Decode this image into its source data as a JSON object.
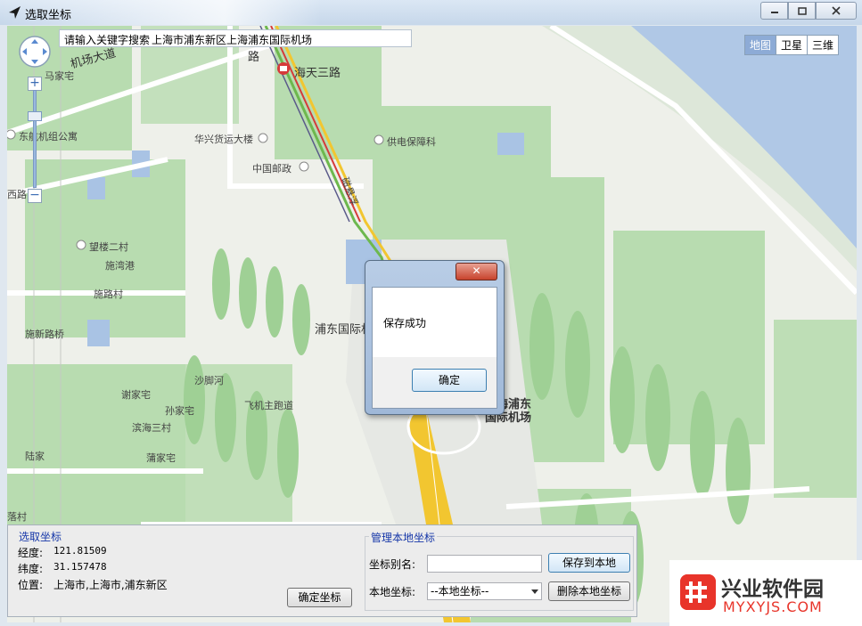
{
  "window": {
    "title": "选取坐标",
    "icon": "cursor-arrow-icon",
    "controls": [
      "minimize-icon",
      "maximize-icon",
      "close-icon"
    ]
  },
  "map": {
    "search": {
      "prompt": "请输入关键字搜索",
      "value": "上海市浦东新区上海浦东国际机场"
    },
    "map_types": [
      {
        "label": "地图",
        "active": true
      },
      {
        "label": "卫星",
        "active": false
      },
      {
        "label": "三维",
        "active": false
      }
    ],
    "zoom_in": "+",
    "zoom_out": "−",
    "labels": {
      "jichang_dadao": "机场大道",
      "majiazhai": "马家宅",
      "haitian_sanlu": "海天三路",
      "road_lu": "路",
      "dongji_gongyu": "东航机组公寓",
      "huaxing": "华兴货运大楼",
      "gongdian": "供电保障科",
      "youzheng": "中国邮政",
      "ciyunxian": "磁悬浮",
      "xilu": "西路",
      "wanglou": "望楼二村",
      "shiwangang": "施湾港",
      "shihu": "施路村",
      "pudong_jichang": "浦东国际机",
      "shixinluqiao": "施新路桥",
      "shajiaohe": "沙脚河",
      "xiejiazhai": "谢家宅",
      "feiji_zhulu": "飞机主跑道",
      "sunjiazhai": "孙家宅",
      "binhai": "滨海三村",
      "lujia": "陆家",
      "pujiazhai": "蒲家宅",
      "luocun": "落村",
      "airport_name_line1": "上海浦东",
      "airport_name_line2": "国际机场"
    }
  },
  "dialog": {
    "message": "保存成功",
    "ok_label": "确定",
    "close_glyph": "✕"
  },
  "panel": {
    "pick": {
      "title": "选取坐标",
      "lng_label": "经度:",
      "lng_value": "121.81509",
      "lat_label": "纬度:",
      "lat_value": "31.157478",
      "loc_label": "位置:",
      "loc_value": "上海市,上海市,浦东新区",
      "confirm_label": "确定坐标"
    },
    "manage": {
      "title": "管理本地坐标",
      "alias_label": "坐标别名:",
      "alias_value": "",
      "save_label": "保存到本地",
      "local_label": "本地坐标:",
      "local_selected": "--本地坐标--",
      "delete_label": "删除本地坐标"
    }
  },
  "watermark": {
    "title": "兴业软件园",
    "url": "MYXYJS.COM"
  }
}
